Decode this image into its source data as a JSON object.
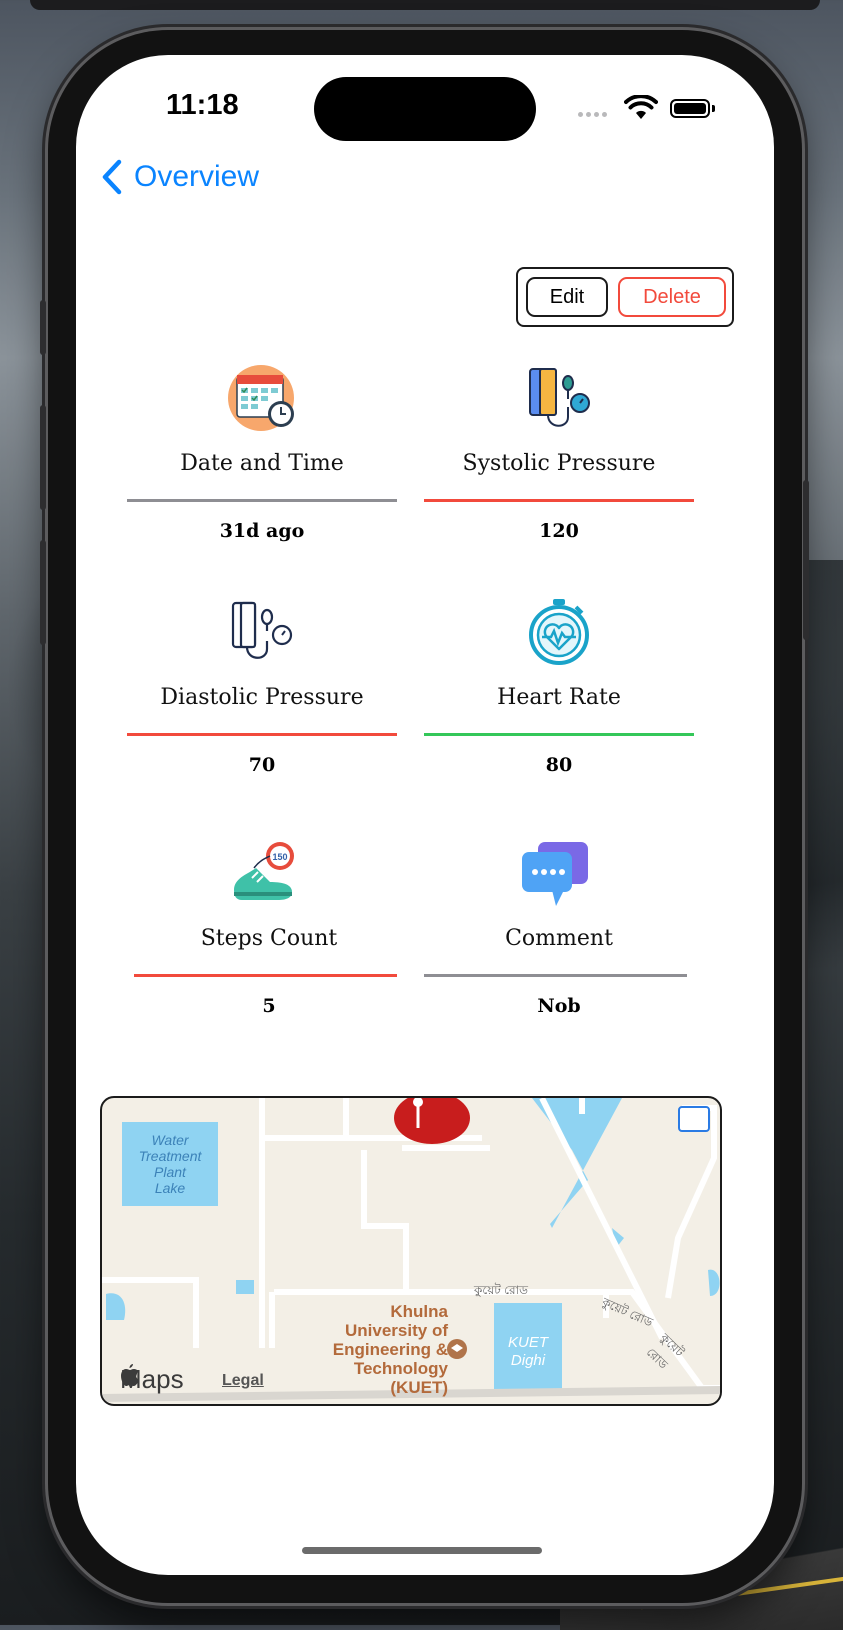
{
  "status_bar": {
    "time": "11:18"
  },
  "nav": {
    "back_label": "Overview"
  },
  "actions": {
    "edit_label": "Edit",
    "delete_label": "Delete"
  },
  "colors": {
    "accent": "#0a84ff",
    "danger": "#f24a3c",
    "ok": "#34c759",
    "neutral": "#8e8e93"
  },
  "metrics": [
    {
      "label": "Date and Time",
      "value": "31d ago",
      "icon": "calendar-clock-icon",
      "status": "neutral"
    },
    {
      "label": "Systolic Pressure",
      "value": "120",
      "icon": "blood-pressure-monitor-icon",
      "status": "danger"
    },
    {
      "label": "Diastolic Pressure",
      "value": "70",
      "icon": "blood-pressure-outline-icon",
      "status": "danger"
    },
    {
      "label": "Heart Rate",
      "value": "80",
      "icon": "heart-rate-stopwatch-icon",
      "status": "ok"
    },
    {
      "label": "Steps Count",
      "value": "5",
      "icon": "running-shoe-icon",
      "status": "danger"
    },
    {
      "label": "Comment",
      "value": "Nob",
      "icon": "chat-bubbles-icon",
      "status": "neutral"
    }
  ],
  "map": {
    "place_lake": [
      "Water",
      "Treatment",
      "Plant",
      "Lake"
    ],
    "place_university": [
      "Khulna",
      "University of",
      "Engineering &",
      "Technology",
      "(KUET)"
    ],
    "place_dighi": [
      "KUET",
      "Dighi"
    ],
    "road_labels": [
      "কুয়েট রোড",
      "কুয়েট রোড",
      "কুয়েট রোড"
    ],
    "brand": "Maps",
    "legal": "Legal",
    "shoe_badge": "150"
  }
}
